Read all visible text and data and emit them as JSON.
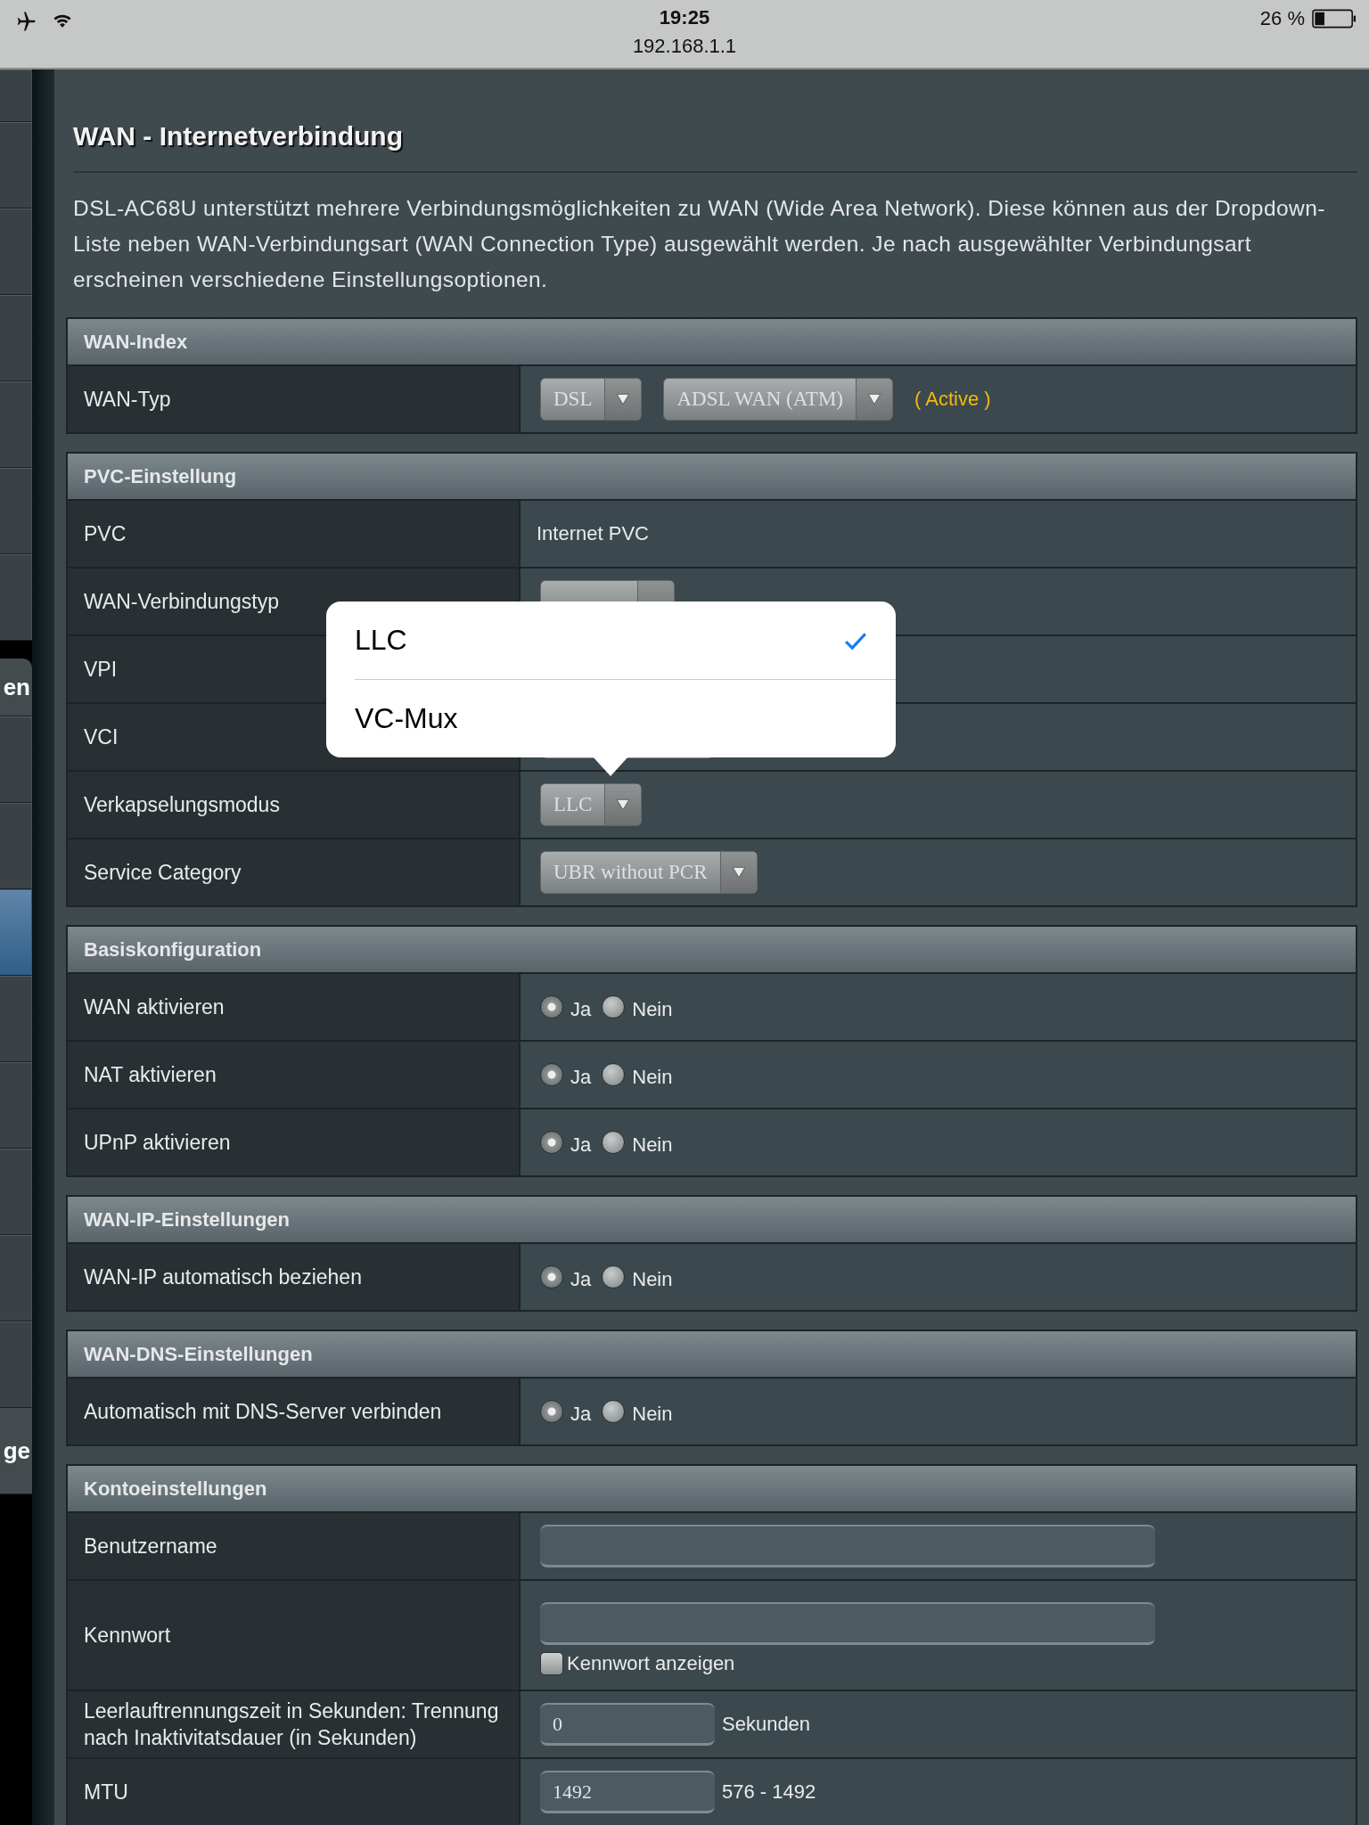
{
  "status_bar": {
    "time": "19:25",
    "url": "192.168.1.1",
    "battery": "26 %"
  },
  "sidebar": {
    "items": [
      {
        "kind": "item",
        "selected": false
      },
      {
        "kind": "item",
        "selected": false
      },
      {
        "kind": "item",
        "selected": false
      },
      {
        "kind": "item",
        "selected": false
      },
      {
        "kind": "item",
        "selected": false
      },
      {
        "kind": "item",
        "selected": false
      },
      {
        "kind": "item",
        "selected": false
      },
      {
        "kind": "group",
        "label": "en"
      },
      {
        "kind": "item",
        "selected": false
      },
      {
        "kind": "item",
        "selected": false
      },
      {
        "kind": "item",
        "selected": true
      },
      {
        "kind": "item",
        "selected": false
      },
      {
        "kind": "item",
        "selected": false
      },
      {
        "kind": "item",
        "selected": false
      },
      {
        "kind": "item",
        "selected": false
      },
      {
        "kind": "item",
        "selected": false
      },
      {
        "kind": "group",
        "label": "ge"
      }
    ]
  },
  "page": {
    "title": "WAN - Internetverbindung",
    "description": "DSL-AC68U unterstützt mehrere Verbindungsmöglichkeiten zu WAN (Wide Area Network). Diese können aus der Dropdown-Liste neben WAN-Verbindungsart (WAN Connection Type) ausgewählt werden. Je nach ausgewählter Verbindungsart erscheinen verschiedene Einstellungsoptionen."
  },
  "sections": [
    {
      "title": "WAN-Index",
      "rows": [
        {
          "label": "WAN-Typ",
          "kind": "selects",
          "selects": [
            {
              "value": "DSL"
            },
            {
              "value": "ADSL WAN (ATM)"
            }
          ],
          "status": "( Active )"
        }
      ]
    },
    {
      "title": "PVC-Einstellung",
      "popover": {
        "options": [
          {
            "label": "LLC",
            "selected": true
          },
          {
            "label": "VC-Mux",
            "selected": false
          }
        ]
      },
      "rows": [
        {
          "label": "PVC",
          "kind": "text",
          "value": "Internet PVC"
        },
        {
          "label": "WAN-Verbindungstyp",
          "kind": "select"
        },
        {
          "label": "VPI",
          "kind": "covered"
        },
        {
          "label": "VCI",
          "kind": "short_field"
        },
        {
          "label": "Verkapselungsmodus",
          "kind": "select",
          "value": "LLC"
        },
        {
          "label": "Service Category",
          "kind": "select",
          "value": "UBR without PCR"
        }
      ]
    },
    {
      "title": "Basiskonfiguration",
      "rows": [
        {
          "label": "WAN aktivieren",
          "kind": "radio",
          "options": [
            {
              "label": "Ja",
              "selected": true
            },
            {
              "label": "Nein",
              "selected": false
            }
          ]
        },
        {
          "label": "NAT aktivieren",
          "kind": "radio",
          "options": [
            {
              "label": "Ja",
              "selected": true
            },
            {
              "label": "Nein",
              "selected": false
            }
          ]
        },
        {
          "label": "UPnP aktivieren",
          "kind": "radio",
          "options": [
            {
              "label": "Ja",
              "selected": true
            },
            {
              "label": "Nein",
              "selected": false
            }
          ]
        }
      ]
    },
    {
      "title": "WAN-IP-Einstellungen",
      "rows": [
        {
          "label": "WAN-IP automatisch beziehen",
          "kind": "radio",
          "options": [
            {
              "label": "Ja",
              "selected": true
            },
            {
              "label": "Nein",
              "selected": false
            }
          ]
        }
      ]
    },
    {
      "title": "WAN-DNS-Einstellungen",
      "rows": [
        {
          "label": "Automatisch mit DNS-Server verbinden",
          "kind": "radio",
          "options": [
            {
              "label": "Ja",
              "selected": true
            },
            {
              "label": "Nein",
              "selected": false
            }
          ]
        }
      ]
    },
    {
      "title": "Kontoeinstellungen",
      "rows": [
        {
          "label": "Benutzername",
          "kind": "field"
        },
        {
          "label": "Kennwort",
          "kind": "password",
          "checkbox": {
            "label": "Kennwort anzeigen",
            "checked": false
          }
        },
        {
          "label": "Leerlauftrennungszeit in Sekunden: Trennung nach Inaktivitatsdauer (in Sekunden)",
          "kind": "short_field",
          "value": "0",
          "unit": "Sekunden"
        },
        {
          "label": "MTU",
          "kind": "short_field",
          "value": "1492",
          "unit": "576 - 1492"
        }
      ]
    }
  ]
}
